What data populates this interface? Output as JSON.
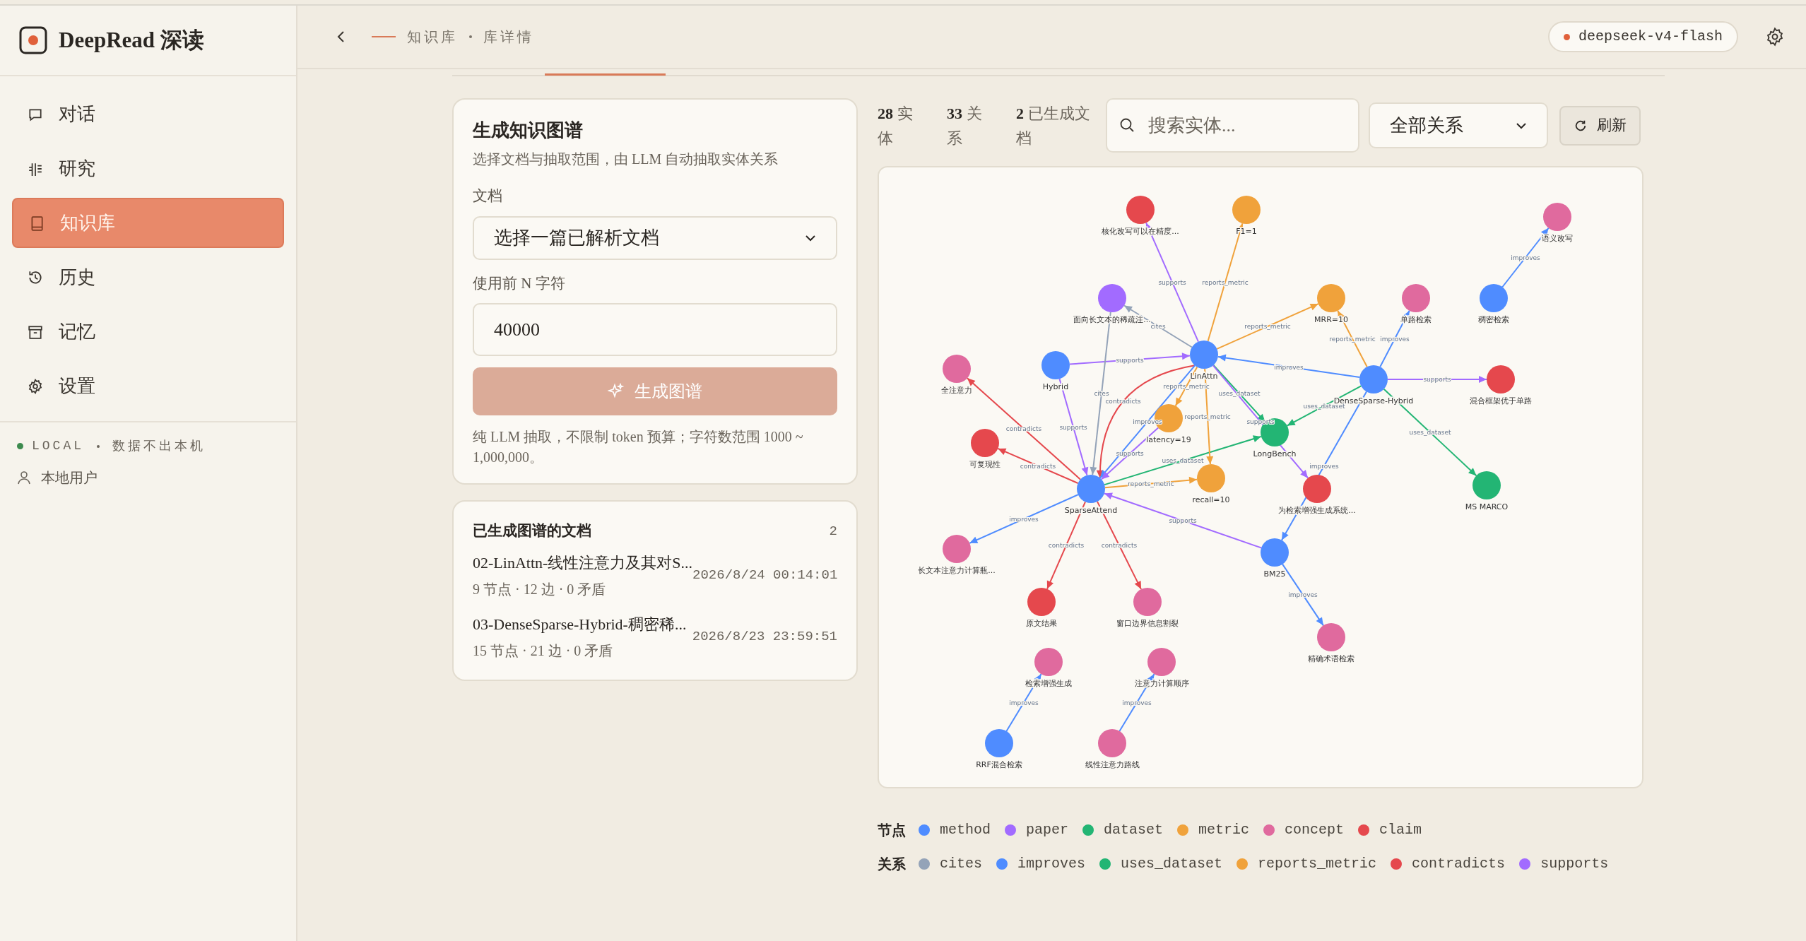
{
  "app": {
    "name": "DeepRead 深读"
  },
  "sidebar": {
    "items": [
      {
        "label": "对话",
        "kind": "chat",
        "selected": false
      },
      {
        "label": "研究",
        "kind": "research",
        "selected": false
      },
      {
        "label": "知识库",
        "kind": "library",
        "selected": true
      },
      {
        "label": "历史",
        "kind": "history",
        "selected": false
      },
      {
        "label": "记忆",
        "kind": "memory",
        "selected": false
      },
      {
        "label": "设置",
        "kind": "settings",
        "selected": false
      }
    ],
    "mode": "LOCAL",
    "mode_note": "数据不出本机",
    "user": "本地用户"
  },
  "breadcrumb": [
    "知识库",
    "库详情"
  ],
  "model_pill": "deepseek-v4-flash",
  "generate_card": {
    "title": "生成知识图谱",
    "subtitle": "选择文档与抽取范围，由 LLM 自动抽取实体关系",
    "document_label": "文档",
    "document_select": "选择一篇已解析文档",
    "chars_label": "使用前 N 字符",
    "chars_value": "40000",
    "button": "生成图谱",
    "button_disabled": true,
    "note": "纯 LLM 抽取，不限制 token 预算；字符数范围 1000 ~ 1,000,000。"
  },
  "docs_card": {
    "title": "已生成图谱的文档",
    "count": "2",
    "docs": [
      {
        "title": "02-LinAttn-线性注意力及其对S...",
        "meta": "9 节点 · 12 边 · 0 矛盾",
        "time": "2026/8/24 00:14:01"
      },
      {
        "title": "03-DenseSparse-Hybrid-稠密稀...",
        "meta": "15 节点 · 21 边 · 0 矛盾",
        "time": "2026/8/23 23:59:51"
      }
    ]
  },
  "stats": [
    {
      "value": "28",
      "label": "实体"
    },
    {
      "value": "33",
      "label": "关系"
    },
    {
      "value": "2",
      "label": "已生成文档"
    }
  ],
  "search": {
    "placeholder": "搜索实体..."
  },
  "relation_filter": "全部关系",
  "refresh_button": "刷新",
  "graph": {
    "nodes": [
      {
        "label": "核化改写可以在精度...",
        "kind": "claim"
      },
      {
        "label": "F1=1",
        "kind": "metric"
      },
      {
        "label": "语义改写",
        "kind": "concept"
      },
      {
        "label": "面向长文本的稀疏注...",
        "kind": "paper"
      },
      {
        "label": "MRR=10",
        "kind": "metric"
      },
      {
        "label": "单路检索",
        "kind": "concept"
      },
      {
        "label": "稠密检索",
        "kind": "method"
      },
      {
        "label": "全注意力",
        "kind": "concept"
      },
      {
        "label": "Hybrid",
        "kind": "method"
      },
      {
        "label": "LinAttn",
        "kind": "method"
      },
      {
        "label": "DenseSparse-Hybrid",
        "kind": "method"
      },
      {
        "label": "混合框架优于单路",
        "kind": "claim"
      },
      {
        "label": "可复现性",
        "kind": "claim"
      },
      {
        "label": "latency=19",
        "kind": "metric"
      },
      {
        "label": "LongBench",
        "kind": "dataset"
      },
      {
        "label": "SparseAttend",
        "kind": "method"
      },
      {
        "label": "recall=10",
        "kind": "metric"
      },
      {
        "label": "为检索增强生成系统...",
        "kind": "claim"
      },
      {
        "label": "MS MARCO",
        "kind": "dataset"
      },
      {
        "label": "长文本注意力计算瓶...",
        "kind": "concept"
      },
      {
        "label": "BM25",
        "kind": "method"
      },
      {
        "label": "原文结果",
        "kind": "claim"
      },
      {
        "label": "窗口边界信息割裂",
        "kind": "concept"
      },
      {
        "label": "精确术语检索",
        "kind": "concept"
      },
      {
        "label": "检索增强生成",
        "kind": "concept"
      },
      {
        "label": "注意力计算顺序",
        "kind": "concept"
      },
      {
        "label": "RRF混合检索",
        "kind": "method"
      },
      {
        "label": "线性注意力路线",
        "kind": "concept"
      }
    ],
    "edges": [
      {
        "relation": "supports"
      },
      {
        "relation": "reports_metric"
      },
      {
        "relation": "cites"
      },
      {
        "relation": "reports_metric"
      },
      {
        "relation": "improves"
      },
      {
        "relation": "improves"
      },
      {
        "relation": "reports_metric"
      },
      {
        "relation": "improves"
      },
      {
        "relation": "supports"
      },
      {
        "relation": "uses_dataset"
      },
      {
        "relation": "uses_dataset"
      },
      {
        "relation": "improves"
      },
      {
        "relation": "supports"
      },
      {
        "relation": "contradicts"
      },
      {
        "relation": "supports"
      },
      {
        "relation": "contradicts"
      },
      {
        "relation": "improves"
      },
      {
        "relation": "contradicts"
      },
      {
        "relation": "contradicts"
      },
      {
        "relation": "reports_metric"
      },
      {
        "relation": "uses_dataset"
      },
      {
        "relation": "contradicts"
      },
      {
        "relation": "improves"
      },
      {
        "relation": "reports_metric"
      },
      {
        "relation": "reports_metric"
      },
      {
        "relation": "supports"
      },
      {
        "relation": "uses_dataset"
      },
      {
        "relation": "supports"
      },
      {
        "relation": "cites"
      },
      {
        "relation": "improves"
      },
      {
        "relation": "supports"
      },
      {
        "relation": "improves"
      },
      {
        "relation": "improves"
      }
    ]
  },
  "legend": {
    "nodes_label": "节点",
    "node_kinds": [
      "method",
      "paper",
      "dataset",
      "metric",
      "concept",
      "claim"
    ],
    "relations_label": "关系",
    "relations": [
      "cites",
      "improves",
      "uses_dataset",
      "reports_metric",
      "contradicts",
      "supports"
    ]
  }
}
